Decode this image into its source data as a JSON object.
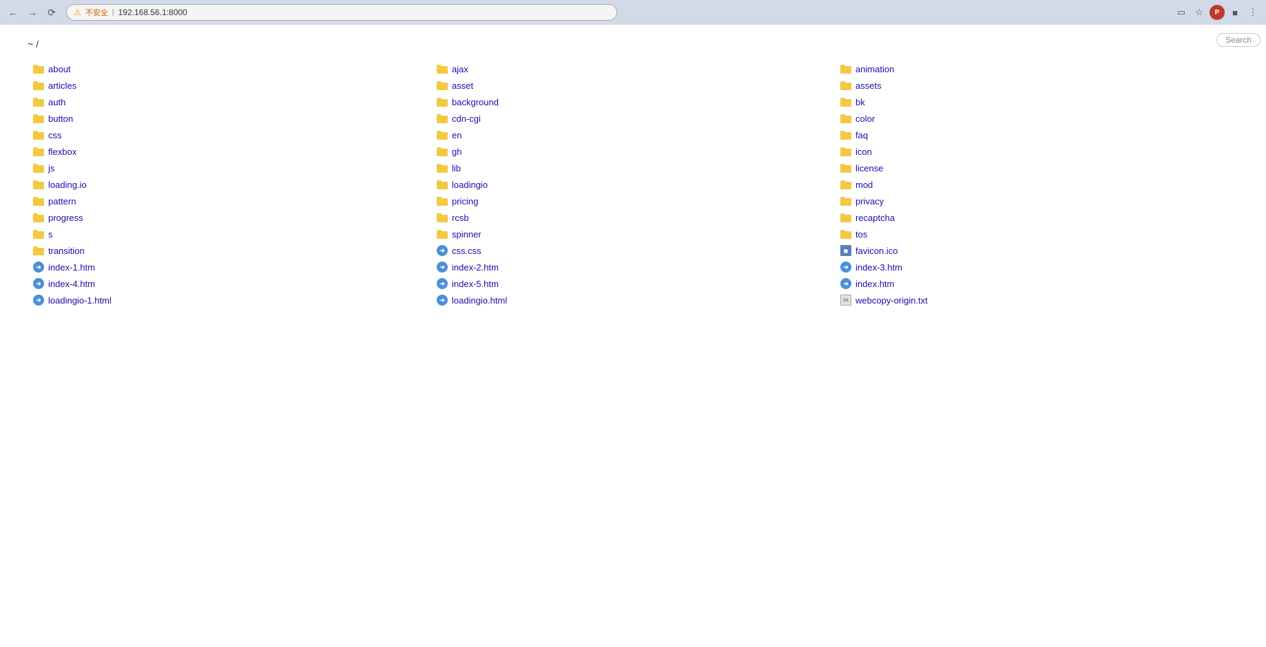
{
  "browser": {
    "address": "192.168.56.1:8000",
    "warning_text": "不安全",
    "search_placeholder": "Search"
  },
  "page": {
    "breadcrumb": "~ /",
    "columns": [
      [
        {
          "type": "folder",
          "name": "about"
        },
        {
          "type": "folder",
          "name": "articles"
        },
        {
          "type": "folder",
          "name": "auth"
        },
        {
          "type": "folder",
          "name": "button"
        },
        {
          "type": "folder",
          "name": "css"
        },
        {
          "type": "folder",
          "name": "flexbox"
        },
        {
          "type": "folder",
          "name": "js"
        },
        {
          "type": "folder",
          "name": "loading.io"
        },
        {
          "type": "folder",
          "name": "pattern"
        },
        {
          "type": "folder",
          "name": "progress"
        },
        {
          "type": "folder",
          "name": "s"
        },
        {
          "type": "folder",
          "name": "transition"
        },
        {
          "type": "html",
          "name": "index-1.htm"
        },
        {
          "type": "html",
          "name": "index-4.htm"
        },
        {
          "type": "html",
          "name": "loadingio-1.html"
        }
      ],
      [
        {
          "type": "folder",
          "name": "ajax"
        },
        {
          "type": "folder",
          "name": "asset"
        },
        {
          "type": "folder",
          "name": "background"
        },
        {
          "type": "folder",
          "name": "cdn-cgi"
        },
        {
          "type": "folder",
          "name": "en"
        },
        {
          "type": "folder",
          "name": "gh"
        },
        {
          "type": "folder",
          "name": "lib"
        },
        {
          "type": "folder",
          "name": "loadingio"
        },
        {
          "type": "folder",
          "name": "pricing"
        },
        {
          "type": "folder",
          "name": "rcsb"
        },
        {
          "type": "folder",
          "name": "spinner"
        },
        {
          "type": "css",
          "name": "css.css"
        },
        {
          "type": "html",
          "name": "index-2.htm"
        },
        {
          "type": "html",
          "name": "index-5.htm"
        },
        {
          "type": "html",
          "name": "loadingio.html"
        }
      ],
      [
        {
          "type": "folder",
          "name": "animation"
        },
        {
          "type": "folder",
          "name": "assets"
        },
        {
          "type": "folder",
          "name": "bk"
        },
        {
          "type": "folder",
          "name": "color"
        },
        {
          "type": "folder",
          "name": "faq"
        },
        {
          "type": "folder",
          "name": "icon"
        },
        {
          "type": "folder",
          "name": "license"
        },
        {
          "type": "folder",
          "name": "mod"
        },
        {
          "type": "folder",
          "name": "privacy"
        },
        {
          "type": "folder",
          "name": "recaptcha"
        },
        {
          "type": "folder",
          "name": "tos"
        },
        {
          "type": "image",
          "name": "favicon.ico"
        },
        {
          "type": "html",
          "name": "index-3.htm"
        },
        {
          "type": "html",
          "name": "index.htm"
        },
        {
          "type": "txt",
          "name": "webcopy-origin.txt"
        }
      ]
    ]
  }
}
